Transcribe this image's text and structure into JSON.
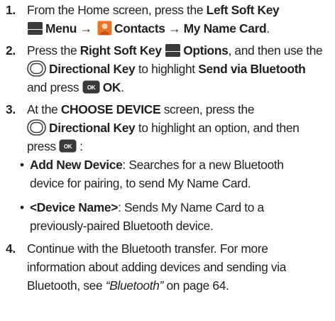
{
  "steps": [
    {
      "number": "1.",
      "line1_a": "From the Home screen, press the ",
      "left_soft_key": "Left Soft Key",
      "menu": "Menu",
      "arrow": "→",
      "contacts": "Contacts",
      "my_name_card": "My Name Card",
      "end": "."
    },
    {
      "number": "2.",
      "text_a": "Press the ",
      "right_soft_key": "Right Soft Key",
      "options": "Options",
      "text_b": ", and then use the",
      "directional_key": "Directional Key",
      "text_c": " to highlight ",
      "send_bluetooth": "Send via Bluetooth",
      "text_d": "and press ",
      "ok": "OK",
      "end": "."
    },
    {
      "number": "3.",
      "text_a": "At the ",
      "choose_device": "CHOOSE DEVICE",
      "text_b": " screen, press the",
      "directional_key": "Directional Key",
      "text_c": " to highlight an option, and then",
      "text_d": "press ",
      "end": ":",
      "bullets": [
        {
          "label": "Add New Device",
          "line1": ": Searches for a new Bluetooth",
          "line2": "device for pairing, to send My Name Card."
        },
        {
          "label": "<Device Name>",
          "line1": ": Sends My Name Card to a",
          "line2": "previously-paired Bluetooth device."
        }
      ]
    },
    {
      "number": "4.",
      "line1": "Continue with the Bluetooth transfer. For more",
      "line2": "information about adding devices and sending via",
      "line3_a": "Bluetooth, see ",
      "ref": "“Bluetooth”",
      "line3_b": " on page 64."
    }
  ],
  "icons": {
    "soft_key": "soft-key-icon",
    "directional_key": "directional-key-icon",
    "ok_key": "ok-key-icon",
    "ok_key_text": "OK",
    "contacts": "contacts-icon"
  },
  "colors": {
    "text": "#231f20",
    "key_fill": "#3a3a3a",
    "contacts_orange": "#e8742a"
  }
}
